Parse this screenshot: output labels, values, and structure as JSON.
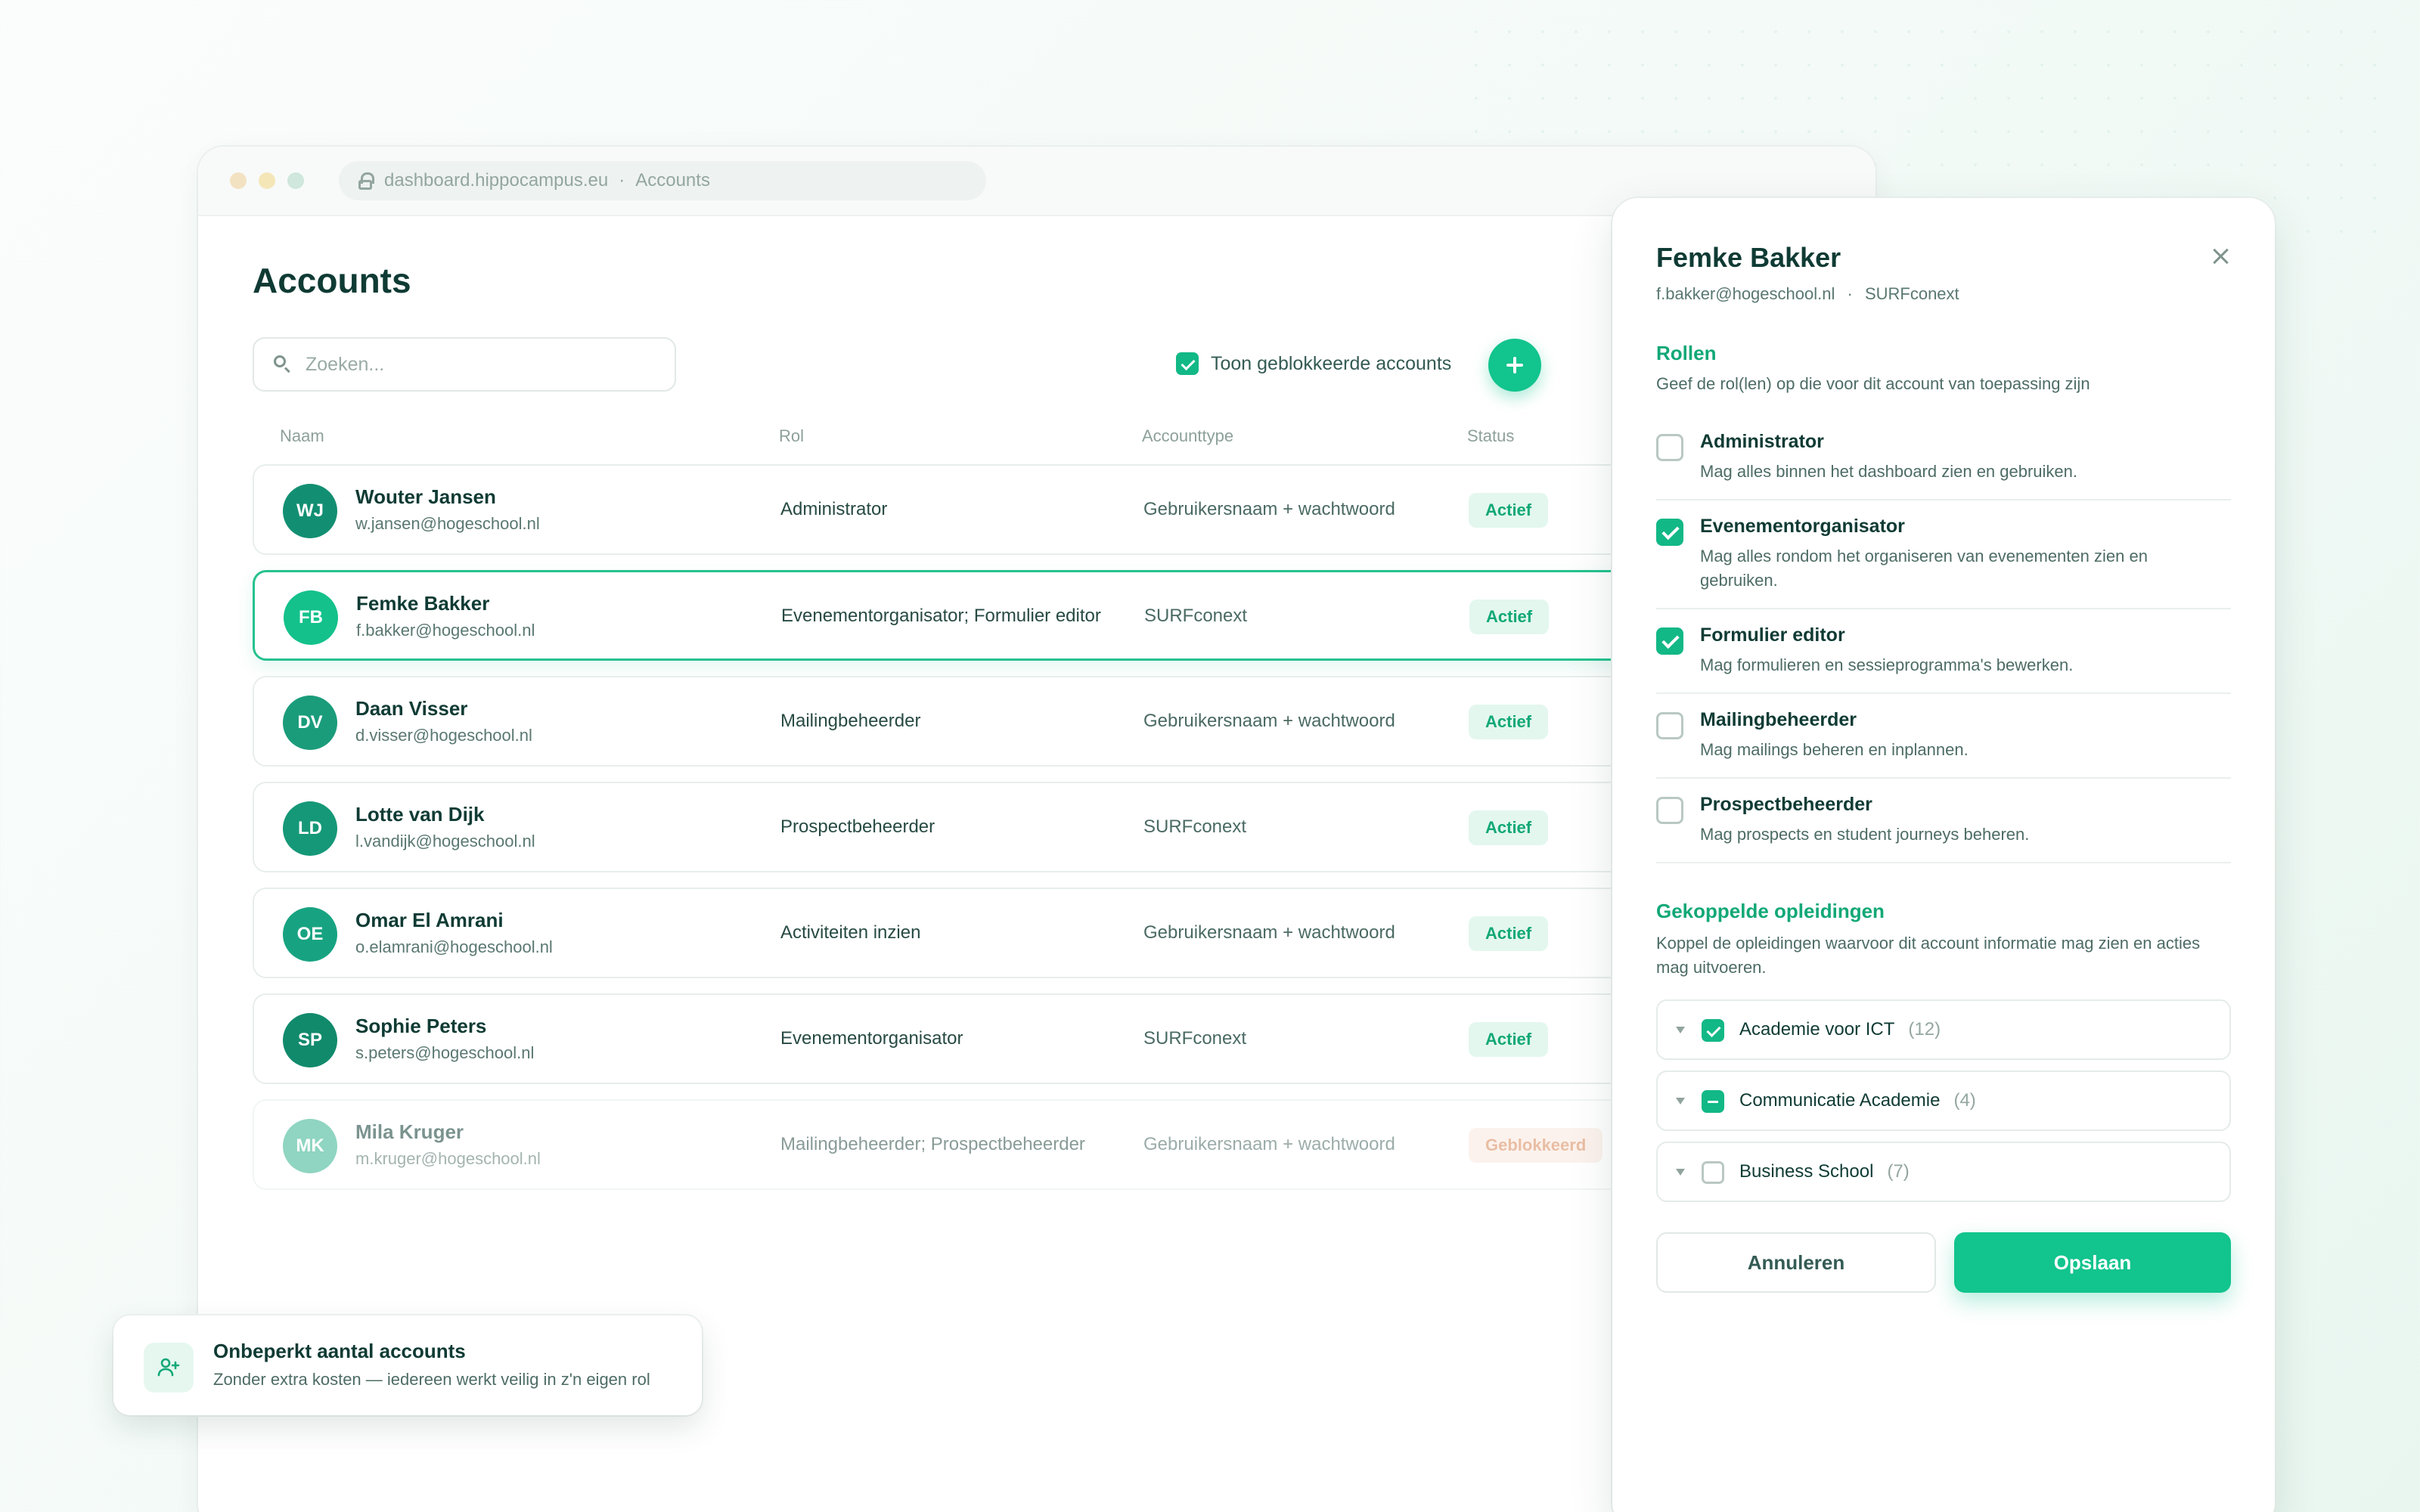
{
  "browser": {
    "url": "dashboard.hippocampus.eu",
    "url_section": "Accounts"
  },
  "page": {
    "title": "Accounts",
    "search_placeholder": "Zoeken...",
    "show_blocked_label": "Toon geblokkeerde accounts",
    "show_blocked_checked": true
  },
  "table": {
    "headers": {
      "name": "Naam",
      "role": "Rol",
      "account_type": "Accounttype",
      "status": "Status"
    },
    "rows": [
      {
        "initials": "WJ",
        "name": "Wouter Jansen",
        "email": "w.jansen@hogeschool.nl",
        "role": "Administrator",
        "account_type": "Gebruikersnaam + wachtwoord",
        "status": "Actief",
        "avatar_color": "#128f72"
      },
      {
        "initials": "FB",
        "name": "Femke Bakker",
        "email": "f.bakker@hogeschool.nl",
        "role": "Evenementorganisator; Formulier editor",
        "account_type": "SURFconext",
        "status": "Actief",
        "avatar_color": "#14c18b"
      },
      {
        "initials": "DV",
        "name": "Daan Visser",
        "email": "d.visser@hogeschool.nl",
        "role": "Mailingbeheerder",
        "account_type": "Gebruikersnaam + wachtwoord",
        "status": "Actief",
        "avatar_color": "#1a9c7b"
      },
      {
        "initials": "LD",
        "name": "Lotte van Dijk",
        "email": "l.vandijk@hogeschool.nl",
        "role": "Prospectbeheerder",
        "account_type": "SURFconext",
        "status": "Actief",
        "avatar_color": "#159878"
      },
      {
        "initials": "OE",
        "name": "Omar El Amrani",
        "email": "o.elamrani@hogeschool.nl",
        "role": "Activiteiten inzien",
        "account_type": "Gebruikersnaam + wachtwoord",
        "status": "Actief",
        "avatar_color": "#17a381"
      },
      {
        "initials": "SP",
        "name": "Sophie Peters",
        "email": "s.peters@hogeschool.nl",
        "role": "Evenementorganisator",
        "account_type": "SURFconext",
        "status": "Actief",
        "avatar_color": "#118a6c"
      },
      {
        "initials": "MK",
        "name": "Mila Kruger",
        "email": "m.kruger@hogeschool.nl",
        "role": "Mailingbeheerder; Prospectbeheerder",
        "account_type": "Gebruikersnaam + wachtwoord",
        "status": "Geblokkeerd",
        "avatar_color": "#34b38f"
      }
    ]
  },
  "panel": {
    "name": "Femke Bakker",
    "email": "f.bakker@hogeschool.nl",
    "auth": "SURFconext",
    "roles_title": "Rollen",
    "roles_desc": "Geef de rol(len) op die voor dit account van toepassing zijn",
    "roles": [
      {
        "name": "Administrator",
        "desc": "Mag alles binnen het dashboard zien en gebruiken.",
        "checked": false
      },
      {
        "name": "Evenementorganisator",
        "desc": "Mag alles rondom het organiseren van evenementen zien en gebruiken.",
        "checked": true
      },
      {
        "name": "Formulier editor",
        "desc": "Mag formulieren en sessieprogramma's bewerken.",
        "checked": true
      },
      {
        "name": "Mailingbeheerder",
        "desc": "Mag mailings beheren en inplannen.",
        "checked": false
      },
      {
        "name": "Prospectbeheerder",
        "desc": "Mag prospects en student journeys beheren.",
        "checked": false
      }
    ],
    "programs_title": "Gekoppelde opleidingen",
    "programs_desc": "Koppel de opleidingen waarvoor dit account informatie mag zien en acties mag uitvoeren.",
    "programs": [
      {
        "name": "Academie voor ICT",
        "count": "(12)",
        "state": "checked"
      },
      {
        "name": "Communicatie Academie",
        "count": "(4)",
        "state": "partial"
      },
      {
        "name": "Business School",
        "count": "(7)",
        "state": "unchecked"
      }
    ],
    "cancel_label": "Annuleren",
    "save_label": "Opslaan"
  },
  "toast": {
    "title": "Onbeperkt aantal accounts",
    "subtitle": "Zonder extra kosten — iedereen werkt veilig in z'n eigen rol",
    "icon": "user-plus-icon"
  },
  "colors": {
    "accent": "#12c48d",
    "accent_text": "#12a877",
    "blocked": "#d88a5a",
    "text_dark": "#0f3b34"
  }
}
